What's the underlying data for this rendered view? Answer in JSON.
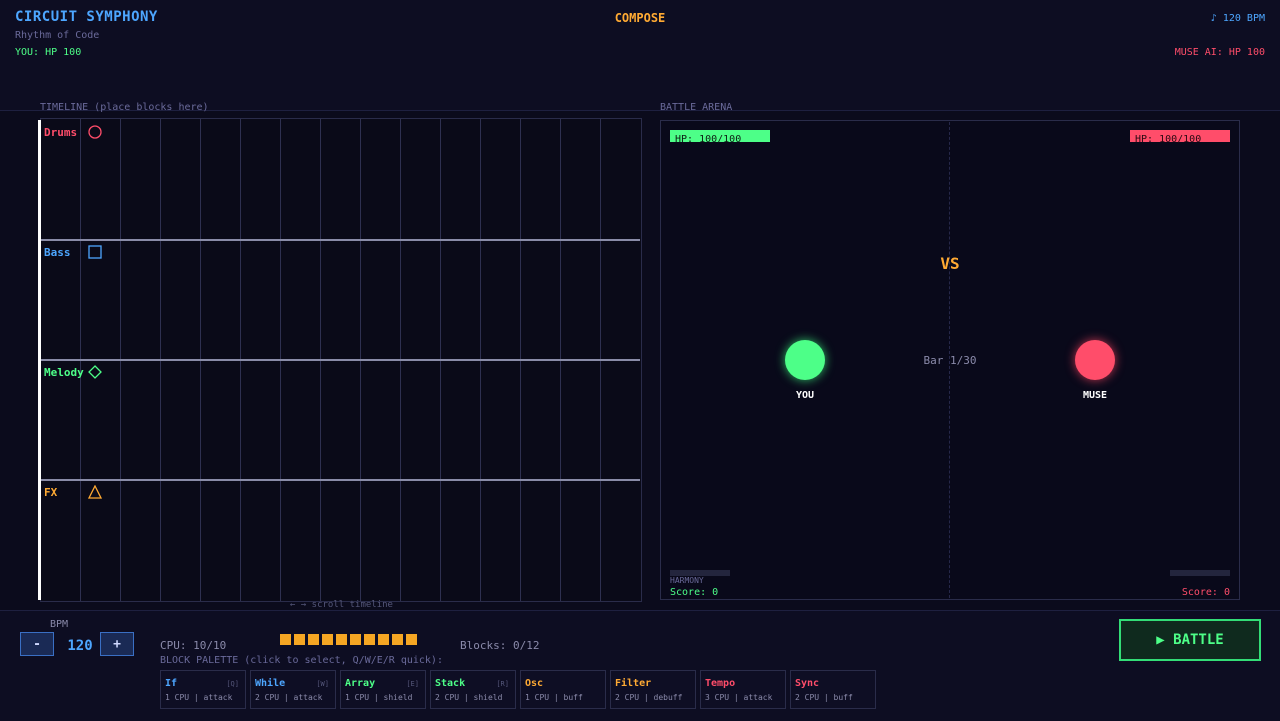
{
  "header": {
    "title": "CIRCUIT SYMPHONY",
    "subtitle": "Rhythm of Code",
    "player_hp": "YOU: HP 100",
    "mode": "COMPOSE",
    "bpm_display": "♪ 120 BPM",
    "enemy_hp": "MUSE AI: HP 100"
  },
  "timeline": {
    "label": "TIMELINE (place blocks here)",
    "scroll_hint": "← → scroll timeline",
    "tracks": [
      {
        "name": "Drums",
        "icon": "circle-icon",
        "color": "#ff4d6a"
      },
      {
        "name": "Bass",
        "icon": "square-icon",
        "color": "#4da6ff"
      },
      {
        "name": "Melody",
        "icon": "diamond-icon",
        "color": "#4dff88"
      },
      {
        "name": "FX",
        "icon": "triangle-icon",
        "color": "#ffaa33"
      }
    ]
  },
  "arena": {
    "label": "BATTLE ARENA",
    "player_hp_text": "HP: 100/100",
    "enemy_hp_text": "HP: 100/100",
    "vs": "VS",
    "bar_counter": "Bar 1/30",
    "player_name": "YOU",
    "enemy_name": "MUSE",
    "harmony_label": "HARMONY",
    "player_score": "Score: 0",
    "enemy_score": "Score: 0",
    "player_color": "#4dff88",
    "enemy_color": "#ff4d6a"
  },
  "controls": {
    "bpm_label": "BPM",
    "bpm_value": "120",
    "bpm_minus": "-",
    "bpm_plus": "+",
    "cpu_text": "CPU: 10/10",
    "cpu_available": 10,
    "blocks_text": "Blocks: 0/12",
    "palette_label": "BLOCK PALETTE (click to select, Q/W/E/R quick):",
    "battle_label": "▶ BATTLE"
  },
  "palette": [
    {
      "name": "If",
      "key": "[Q]",
      "desc": "1 CPU | attack",
      "color": "#4da6ff"
    },
    {
      "name": "While",
      "key": "[W]",
      "desc": "2 CPU | attack",
      "color": "#4da6ff"
    },
    {
      "name": "Array",
      "key": "[E]",
      "desc": "1 CPU | shield",
      "color": "#4dff88"
    },
    {
      "name": "Stack",
      "key": "[R]",
      "desc": "2 CPU | shield",
      "color": "#4dff88"
    },
    {
      "name": "Osc",
      "key": "",
      "desc": "1 CPU | buff",
      "color": "#ffaa33"
    },
    {
      "name": "Filter",
      "key": "",
      "desc": "2 CPU | debuff",
      "color": "#ffaa33"
    },
    {
      "name": "Tempo",
      "key": "",
      "desc": "3 CPU | attack",
      "color": "#ff4d6a"
    },
    {
      "name": "Sync",
      "key": "",
      "desc": "2 CPU | buff",
      "color": "#ff4d6a"
    }
  ]
}
